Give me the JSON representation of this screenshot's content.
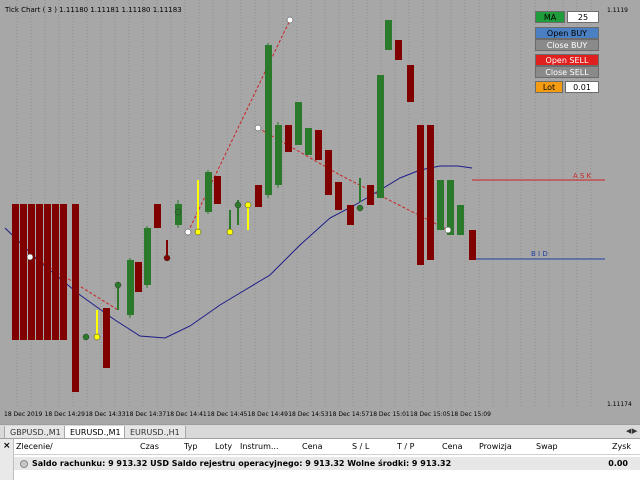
{
  "chart": {
    "title": "Tick Chart ( 3 ) 1.11180 1.11181 1.11180 1.11183",
    "price_top": "1.1119",
    "price_bottom": "1.11174",
    "ask_label": "A S K",
    "bid_label": "B I D",
    "time_labels": [
      "18 Dec 2019",
      "18 Dec 14:29",
      "18 Dec 14:33",
      "18 Dec 14:37",
      "18 Dec 14:41",
      "18 Dec 14:45",
      "18 Dec 14:49",
      "18 Dec 14:53",
      "18 Dec 14:57",
      "18 Dec 15:01",
      "18 Dec 15:05",
      "18 Dec 15:09"
    ],
    "colors": {
      "background": "#a7a7a7",
      "bull": "#2b7a2b",
      "bear": "#800000",
      "ma_line": "#1c1c8a",
      "ask_line": "#cc2222",
      "bid_line": "#1f3f9f",
      "dash_line": "#cc2222",
      "signal_yellow": "#ffff00"
    }
  },
  "panel": {
    "ma_label": "MA",
    "ma_value": "25",
    "open_buy": "Open BUY",
    "close_buy": "Close BUY",
    "open_sell": "Open SELL",
    "close_sell": "Close SELL",
    "lot_label": "Lot",
    "lot_value": "0.01"
  },
  "tabs": [
    {
      "label": "GBPUSD.,M1",
      "active": false
    },
    {
      "label": "EURUSD.,M1",
      "active": true
    },
    {
      "label": "EURUSD.,H1",
      "active": false
    }
  ],
  "terminal": {
    "columns": [
      "Zlecenie",
      "/",
      "Czas",
      "Typ",
      "Loty",
      "Instrum...",
      "Cena",
      "S / L",
      "T / P",
      "Cena",
      "Prowizja",
      "Swap",
      "Zysk"
    ],
    "summary": "Saldo rachunku: 9 913.32 USD  Saldo rejestru operacyjnego: 9 913.32  Wolne środki: 9 913.32",
    "profit": "0.00",
    "close_symbol": "×"
  }
}
